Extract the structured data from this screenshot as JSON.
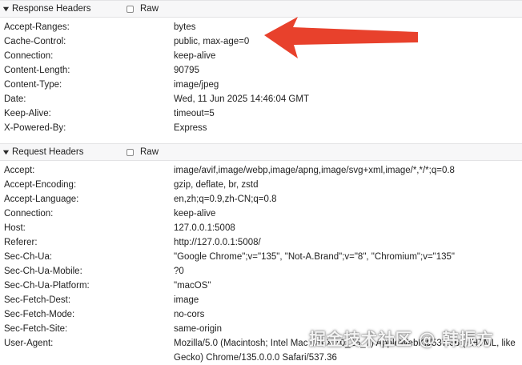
{
  "response_headers": {
    "title": "Response Headers",
    "raw_label": "Raw",
    "rows": [
      {
        "name": "Accept-Ranges:",
        "value": "bytes"
      },
      {
        "name": "Cache-Control:",
        "value": "public, max-age=0"
      },
      {
        "name": "Connection:",
        "value": "keep-alive"
      },
      {
        "name": "Content-Length:",
        "value": "90795"
      },
      {
        "name": "Content-Type:",
        "value": "image/jpeg"
      },
      {
        "name": "Date:",
        "value": "Wed, 11 Jun 2025 14:46:04 GMT"
      },
      {
        "name": "Keep-Alive:",
        "value": "timeout=5"
      },
      {
        "name": "X-Powered-By:",
        "value": "Express"
      }
    ]
  },
  "request_headers": {
    "title": "Request Headers",
    "raw_label": "Raw",
    "rows": [
      {
        "name": "Accept:",
        "value": "image/avif,image/webp,image/apng,image/svg+xml,image/*,*/*;q=0.8"
      },
      {
        "name": "Accept-Encoding:",
        "value": "gzip, deflate, br, zstd"
      },
      {
        "name": "Accept-Language:",
        "value": "en,zh;q=0.9,zh-CN;q=0.8"
      },
      {
        "name": "Connection:",
        "value": "keep-alive"
      },
      {
        "name": "Host:",
        "value": "127.0.0.1:5008"
      },
      {
        "name": "Referer:",
        "value": "http://127.0.0.1:5008/"
      },
      {
        "name": "Sec-Ch-Ua:",
        "value": "\"Google Chrome\";v=\"135\", \"Not-A.Brand\";v=\"8\", \"Chromium\";v=\"135\""
      },
      {
        "name": "Sec-Ch-Ua-Mobile:",
        "value": "?0"
      },
      {
        "name": "Sec-Ch-Ua-Platform:",
        "value": "\"macOS\""
      },
      {
        "name": "Sec-Fetch-Dest:",
        "value": "image"
      },
      {
        "name": "Sec-Fetch-Mode:",
        "value": "no-cors"
      },
      {
        "name": "Sec-Fetch-Site:",
        "value": "same-origin"
      },
      {
        "name": "User-Agent:",
        "value": "Mozilla/5.0 (Macintosh; Intel Mac OS X 10_15_7) AppleWebKit/537.36 (KHTML, like"
      },
      {
        "name": "",
        "value": "Gecko) Chrome/135.0.0.0 Safari/537.36"
      }
    ]
  },
  "annotation": {
    "arrow_color": "#e8412c",
    "icon": "red-arrow-annotation"
  },
  "watermark": {
    "text": "掘金技术社区 @ 韩振方"
  },
  "colors": {
    "header_bg": "#f7f7f8",
    "border": "#e3e3e5",
    "text": "#1f1f1f"
  }
}
